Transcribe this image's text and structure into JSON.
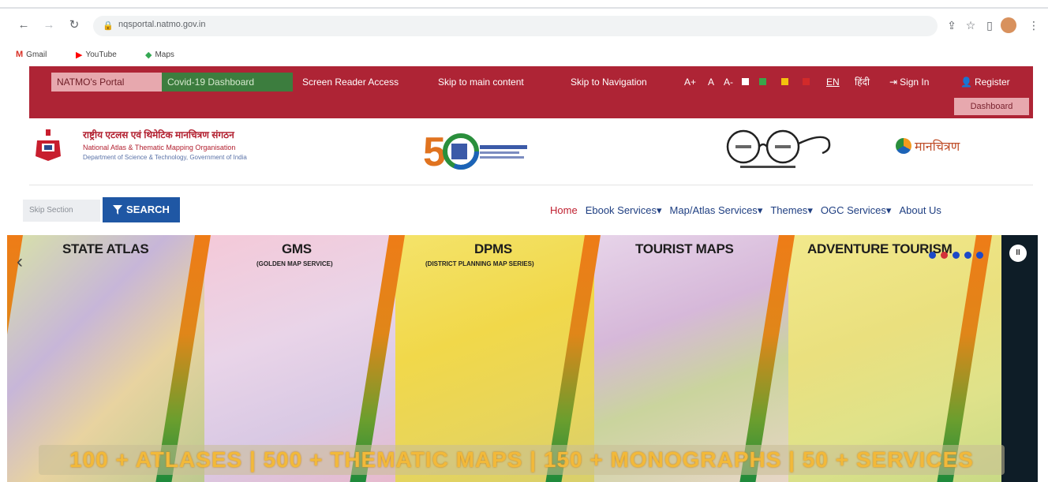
{
  "browser": {
    "url": "nqsportal.natmo.gov.in",
    "bookmarks": [
      {
        "icon": "gmail-icon",
        "label": "Gmail"
      },
      {
        "icon": "youtube-icon",
        "label": "YouTube"
      },
      {
        "icon": "maps-icon",
        "label": "Maps"
      }
    ]
  },
  "topbar": {
    "natmo_portal": "NATMO's Portal",
    "covid_dashboard": "Covid-19 Dashboard",
    "screen_reader": "Screen Reader Access",
    "skip_main": "Skip to main content",
    "skip_nav": "Skip to Navigation",
    "font_plus": "A+",
    "font_normal": "A",
    "font_minus": "A-",
    "lang_en": "EN",
    "lang_hi": "हिंदी",
    "sign_in": "Sign In",
    "register": "Register",
    "dashboard": "Dashboard",
    "theme_colors": [
      "#ffffff",
      "#3aa54a",
      "#f4c20d",
      "#d22a2a"
    ]
  },
  "header": {
    "org_hindi": "राष्ट्रीय एटलस एवं थिमेटिक मानचित्रण संगठन",
    "org_english": "National Atlas & Thematic Mapping Organisation",
    "department": "Department of Science & Technology, Government of India",
    "brand": "मानचित्रण"
  },
  "search": {
    "placeholder": "Skip Section",
    "button": "SEARCH"
  },
  "nav": {
    "items": [
      "Home",
      "Ebook Services",
      "Map/Atlas Services",
      "Themes",
      "OGC Services",
      "About Us"
    ]
  },
  "banner": {
    "panels": [
      {
        "title": "STATE ATLAS",
        "subtitle": ""
      },
      {
        "title": "GMS",
        "subtitle": "(GOLDEN MAP SERVICE)"
      },
      {
        "title": "DPMS",
        "subtitle": "(DISTRICT PLANNING MAP SERIES)"
      },
      {
        "title": "TOURIST MAPS",
        "subtitle": ""
      },
      {
        "title": "ADVENTURE TOURISM",
        "subtitle": ""
      }
    ],
    "stats": "100 + ATLASES | 500 + THEMATIC MAPS | 150 + MONOGRAPHS | 50 + SERVICES"
  }
}
